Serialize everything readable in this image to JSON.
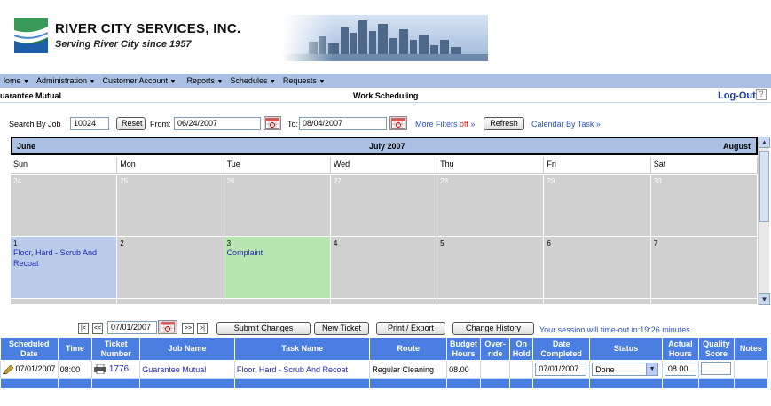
{
  "header": {
    "company": "RIVER CITY SERVICES, INC.",
    "tagline": "Serving River City since 1957"
  },
  "menu": [
    {
      "label": "lome"
    },
    {
      "label": "Administration"
    },
    {
      "label": "Customer Account"
    },
    {
      "label": "Reports"
    },
    {
      "label": "Schedules"
    },
    {
      "label": "Requests"
    }
  ],
  "info": {
    "client": "uarantee Mutual",
    "title": "Work Scheduling",
    "logout": "Log-Out",
    "help": "?"
  },
  "search": {
    "job_label": "Search By Job",
    "job_value": "10024",
    "reset": "Reset",
    "from_label": "From:",
    "from_value": "06/24/2007",
    "to_label": "To:",
    "to_value": "08/04/2007",
    "more_filters": "More Filters",
    "filters_state": "off",
    "refresh": "Refresh",
    "calendar_by_task": "Calendar By Task"
  },
  "calendar": {
    "prev_month": "June",
    "month": "July 2007",
    "next_month": "August",
    "days": [
      "Sun",
      "Mon",
      "Tue",
      "Wed",
      "Thu",
      "Fri",
      "Sat"
    ],
    "week1": [
      "24",
      "25",
      "26",
      "27",
      "28",
      "29",
      "30"
    ],
    "week2": [
      {
        "num": "1",
        "event": "Floor, Hard - Scrub And Recoat"
      },
      {
        "num": "2",
        "event": ""
      },
      {
        "num": "3",
        "event": "Complaint"
      },
      {
        "num": "4",
        "event": ""
      },
      {
        "num": "5",
        "event": ""
      },
      {
        "num": "6",
        "event": ""
      },
      {
        "num": "7",
        "event": ""
      }
    ]
  },
  "toolbar": {
    "first": "|<",
    "prev": "<<",
    "date_value": "07/01/2007",
    "next": ">>",
    "last": ">|",
    "submit": "Submit Changes",
    "new_ticket": "New Ticket",
    "print_export": "Print / Export",
    "change_history": "Change History",
    "session": "Your session will time-out in:19:26 minutes"
  },
  "grid": {
    "headers": [
      "Scheduled Date",
      "Time",
      "Ticket Number",
      "Job Name",
      "Task Name",
      "Route",
      "Budget Hours",
      "Over-ride",
      "On Hold",
      "Date Completed",
      "Status",
      "Actual Hours",
      "Quality Score",
      "Notes"
    ],
    "row": {
      "scheduled_date": "07/01/2007",
      "time": "08:00",
      "ticket_number": "1776",
      "job_name": "Guarantee Mutual",
      "task_name": "Floor, Hard - Scrub And Recoat",
      "route": "Regular Cleaning",
      "budget_hours": "08.00",
      "date_completed": "07/01/2007",
      "status": "Done",
      "actual_hours": "08.00"
    }
  },
  "colors": {
    "menubar": "#a9c0e2",
    "grid_header": "#4a7ee0",
    "link": "#2850c8",
    "event": "#2228b8",
    "blue_day": "#b9cbe8",
    "green_day": "#b7e6b0"
  }
}
